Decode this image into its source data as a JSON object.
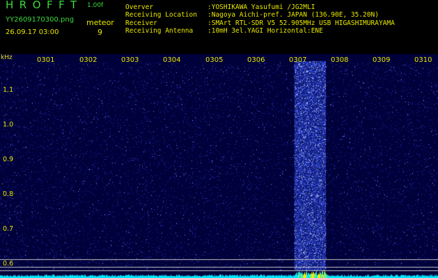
{
  "app": {
    "title": "HROFFT",
    "version": "1.00f"
  },
  "file": {
    "name": "YY2609170300.png",
    "datetime": "26.09.17 03:00"
  },
  "meteor": {
    "label": "meteor",
    "count": "9"
  },
  "info": [
    {
      "key": "Overver",
      "value": ":YOSHIKAWA Yasufumi /JG2MLI"
    },
    {
      "key": "Receiving Location",
      "value": ":Nagoya Aichi-pref. JAPAN (136.90E, 35.20N)"
    },
    {
      "key": "Receiver",
      "value": ":SMArt RTL-SDR V5 52.905MHz USB HIGASHIMURAYAMA"
    },
    {
      "key": "Receiving Antenna",
      "value": ":10mH 3el.YAGI Horizontal:ENE"
    }
  ],
  "spectrogram": {
    "y_unit": "kHz",
    "x_ticks": [
      "0301",
      "0302",
      "0303",
      "0304",
      "0305",
      "0306",
      "0307",
      "0308",
      "0309",
      "0310"
    ],
    "y_ticks": [
      "1.1",
      "1.0",
      "0.9",
      "0.8",
      "0.7",
      "0.6"
    ],
    "y_range_khz": [
      0.57,
      1.16
    ],
    "noise_burst_minutes": [
      6.15,
      6.9
    ],
    "reference_lines_khz": [
      0.62,
      0.6,
      0.59
    ],
    "colors": {
      "background": "#00003a",
      "noise": "#3a50ff",
      "burst": "#4a6aff",
      "baseline": "#00e8ff",
      "ref_line": "#c8c8c8",
      "label": "#e8e800",
      "title": "#3adb3a"
    }
  }
}
